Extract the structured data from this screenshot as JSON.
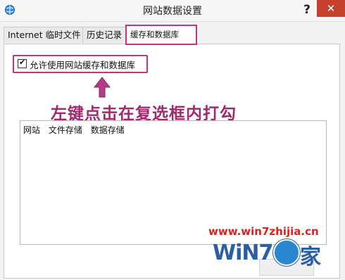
{
  "window": {
    "title": "网站数据设置",
    "help_label": "?",
    "close_label": "✕"
  },
  "tabs": [
    {
      "label": "Internet 临时文件"
    },
    {
      "label": "历史记录"
    },
    {
      "label": "缓存和数据库",
      "selected": true
    }
  ],
  "checkbox": {
    "label": "允许使用网站缓存和数据库",
    "checked": true,
    "mark": "✔"
  },
  "annotation": {
    "text": "左键点击在复选框内打勾",
    "color": "#a02a6e",
    "highlight_color": "#c2357c"
  },
  "table": {
    "columns": [
      "网站",
      "文件存储",
      "数据存储"
    ],
    "rows": []
  },
  "watermark": {
    "url": "www.win7zhijia.cn",
    "logo_text": "WiN7.",
    "logo_suffix": "家"
  }
}
